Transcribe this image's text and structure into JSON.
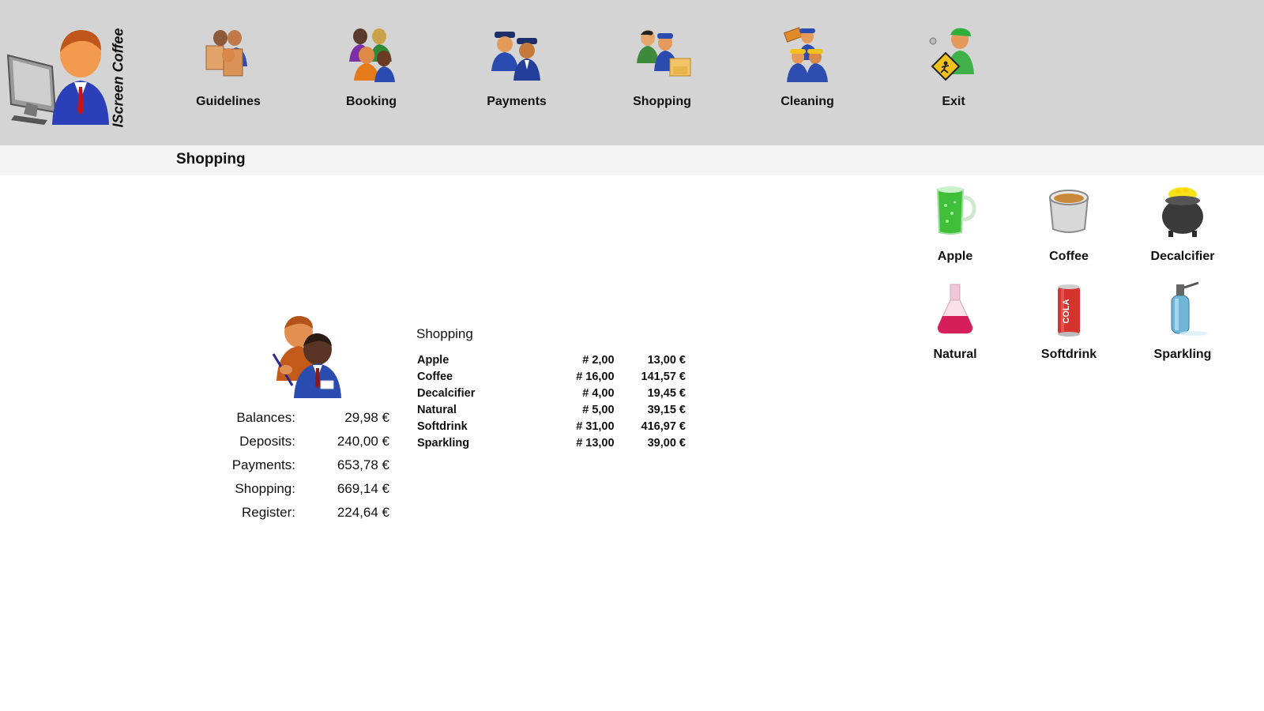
{
  "app": {
    "brand": "IScreen Coffee"
  },
  "nav": [
    {
      "label": "Guidelines",
      "icon": "guidelines-icon"
    },
    {
      "label": "Booking",
      "icon": "booking-icon"
    },
    {
      "label": "Payments",
      "icon": "payments-icon"
    },
    {
      "label": "Shopping",
      "icon": "shopping-icon"
    },
    {
      "label": "Cleaning",
      "icon": "cleaning-icon"
    },
    {
      "label": "Exit",
      "icon": "exit-icon"
    }
  ],
  "page": {
    "title": "Shopping"
  },
  "summary": {
    "rows": [
      {
        "label": "Balances:",
        "value": "29,98 €"
      },
      {
        "label": "Deposits:",
        "value": "240,00 €"
      },
      {
        "label": "Payments:",
        "value": "653,78 €"
      },
      {
        "label": "Shopping:",
        "value": "669,14 €"
      },
      {
        "label": "Register:",
        "value": "224,64 €"
      }
    ]
  },
  "shopping": {
    "title": "Shopping",
    "rows": [
      {
        "name": "Apple",
        "qty": "# 2,00",
        "price": "13,00 €"
      },
      {
        "name": "Coffee",
        "qty": "# 16,00",
        "price": "141,57 €"
      },
      {
        "name": "Decalcifier",
        "qty": "# 4,00",
        "price": "19,45 €"
      },
      {
        "name": "Natural",
        "qty": "# 5,00",
        "price": "39,15 €"
      },
      {
        "name": "Softdrink",
        "qty": "# 31,00",
        "price": "416,97 €"
      },
      {
        "name": "Sparkling",
        "qty": "# 13,00",
        "price": "39,00 €"
      }
    ]
  },
  "products": [
    {
      "label": "Apple",
      "icon": "apple-juice-mug-icon"
    },
    {
      "label": "Coffee",
      "icon": "coffee-bucket-icon"
    },
    {
      "label": "Decalcifier",
      "icon": "decalcifier-pot-icon"
    },
    {
      "label": "Natural",
      "icon": "natural-flask-icon"
    },
    {
      "label": "Softdrink",
      "icon": "cola-can-icon"
    },
    {
      "label": "Sparkling",
      "icon": "soda-siphon-icon"
    }
  ],
  "can_text": "COLA"
}
